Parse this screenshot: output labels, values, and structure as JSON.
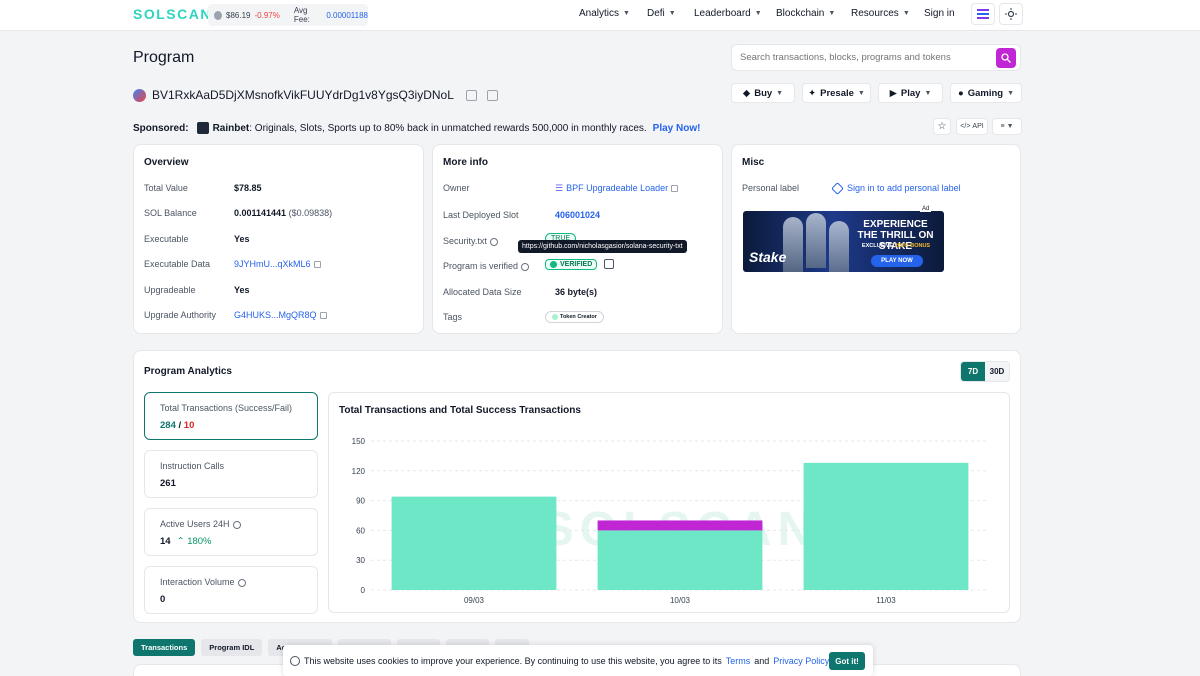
{
  "header": {
    "logo": "SOLSCAN",
    "sol_price": "$86.19",
    "sol_change": "-0.97%",
    "avg_fee_label": "Avg Fee:",
    "avg_fee_value": "0.00001188",
    "nav": [
      "Analytics",
      "Defi",
      "Leaderboard",
      "Blockchain",
      "Resources"
    ],
    "sign_in": "Sign in"
  },
  "page": {
    "title": "Program",
    "address": "BV1RxkAaD5DjXMsnofkVikFUUYdrDg1v8YgsQ3iyDNoL",
    "search_placeholder": "Search transactions, blocks, programs and tokens"
  },
  "action_buttons": [
    "Buy",
    "Presale",
    "Play",
    "Gaming"
  ],
  "sponsored": {
    "label": "Sponsored:",
    "brand": "Rainbet",
    "text": ": Originals, Slots, Sports up to 80% back in unmatched rewards 500,000 in monthly races.",
    "cta": "Play Now!"
  },
  "toolbar": {
    "api": "API"
  },
  "overview": {
    "title": "Overview",
    "rows": [
      {
        "label": "Total Value",
        "value": "$78.85"
      },
      {
        "label": "SOL Balance",
        "value": "0.001141441",
        "extra": "($0.09838)"
      },
      {
        "label": "Executable",
        "value": "Yes"
      },
      {
        "label": "Executable Data",
        "value": "9JYHmU...qXkML6"
      },
      {
        "label": "Upgradeable",
        "value": "Yes"
      },
      {
        "label": "Upgrade Authority",
        "value": "G4HUKS...MgQR8Q"
      }
    ]
  },
  "more_info": {
    "title": "More info",
    "owner_label": "Owner",
    "owner_value": "BPF Upgradeable Loader",
    "slot_label": "Last Deployed Slot",
    "slot_value": "406001024",
    "security_label": "Security.txt",
    "security_badge": "TRUE",
    "security_tooltip": "https://github.com/nicholasgasior/solana-security-txt",
    "verified_label": "Program is verified",
    "verified_badge": "VERIFIED",
    "size_label": "Allocated Data Size",
    "size_value": "36 byte(s)",
    "tags_label": "Tags",
    "tag": "Token Creator"
  },
  "misc": {
    "title": "Misc",
    "personal_label": "Personal label",
    "sign_in_link": "Sign in to add personal label",
    "ad": {
      "label": "Ad",
      "headline": "EXPERIENCE THE THRILL ON STAKE",
      "sub": "EXCLUSIVE",
      "bonus": "200% BONUS",
      "cta": "PLAY NOW",
      "logo": "Stake"
    }
  },
  "analytics": {
    "title": "Program Analytics",
    "ranges": [
      "7D",
      "30D"
    ],
    "active_range": "7D",
    "stats": [
      {
        "label": "Total Transactions (Success/Fail)",
        "success": "284",
        "sep": " / ",
        "fail": "10"
      },
      {
        "label": "Instruction Calls",
        "value": "261"
      },
      {
        "label": "Active Users 24H",
        "value": "14",
        "change": "180%"
      },
      {
        "label": "Interaction Volume",
        "value": "0"
      }
    ]
  },
  "chart_data": {
    "type": "bar",
    "title": "Total Transactions and Total Success Transactions",
    "categories": [
      "09/03",
      "10/03",
      "11/03"
    ],
    "series": [
      {
        "values": [
          94,
          60,
          128
        ],
        "color": "#6ee7c7"
      },
      {
        "values": [
          0,
          10,
          0
        ],
        "color": "#c026d3"
      }
    ],
    "stacked": true,
    "ylim": [
      0,
      150
    ],
    "yticks": [
      0,
      30,
      60,
      90,
      120,
      150
    ],
    "watermark": "SOLSCAN",
    "grid": true
  },
  "tabs": [
    "Transactions",
    "Program IDL",
    "Acco"
  ],
  "cookie": {
    "text": "This website uses cookies to improve your experience. By continuing to use this website, you agree to its",
    "terms": "Terms",
    "and": "and",
    "privacy": "Privacy Policy",
    "dot": ".",
    "button": "Got it!"
  }
}
